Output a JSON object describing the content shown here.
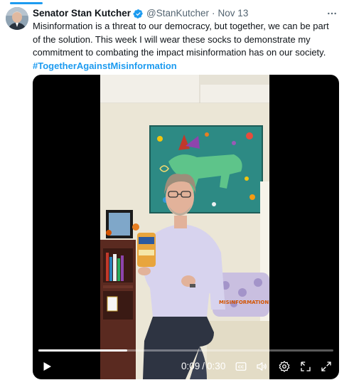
{
  "tweet": {
    "author_name": "Senator Stan Kutcher",
    "handle": "@StanKutcher",
    "separator": "·",
    "date": "Nov 13",
    "text": "Misinformation is a threat to our democracy, but together, we can be part of the solution. This week I will wear these socks to demonstrate my commitment to combating the impact misinformation has on our society.",
    "hashtag": "#TogetherAgainstMisinformation"
  },
  "video": {
    "current_time": "0:09",
    "duration": "0:30",
    "progress": 0.3,
    "overlay_text": "MISINFORMATION"
  },
  "colors": {
    "accent": "#1d9bf0",
    "text": "#0f1419",
    "secondary": "#536471"
  },
  "icons": [
    "verified-icon",
    "more-icon",
    "play-icon",
    "captions-icon",
    "volume-icon",
    "settings-icon",
    "pip-icon",
    "fullscreen-icon"
  ]
}
